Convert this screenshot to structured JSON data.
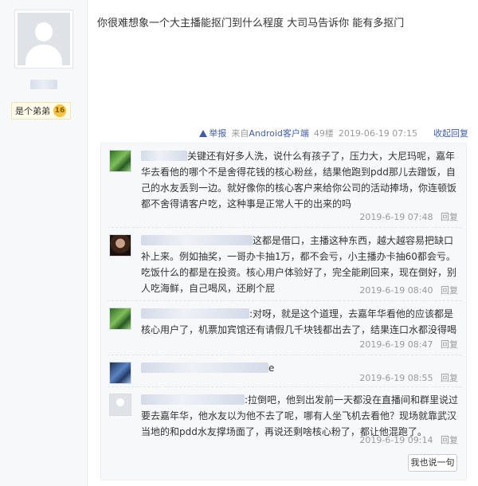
{
  "post": {
    "text": "你很难想象一个大主播能抠门到什么程度 大司马告诉你 能有多抠门",
    "rank_title": "是个弟弟",
    "rank_level": "16"
  },
  "meta": {
    "report": "举报",
    "client_prefix": "来自",
    "client_name": "Android客户端",
    "floor": "49楼",
    "time": "2019-06-19 07:15",
    "collapse": "收起回复"
  },
  "replies": [
    {
      "text": "关键还有好多人洗，说什么有孩子了，压力大，大尼玛呢，嘉年华去看他的哪个不是舍得花钱的核心粉丝，结果他跑到pdd那儿去蹭饭，自己的水友丢到一边。就好像你的核心客户来给你公司的活动捧场，你连顿饭都不舍得请客户吃，这种事是正常人干的出来的吗",
      "time": "2019-6-19 07:48",
      "reply_label": "回复"
    },
    {
      "text": "这都是借口，主播这种东西，越大越容易把缺口补上来。例如抽奖，一哥办卡抽1万，都不会亏，小主播办卡抽60都会亏。吃饭什么的都是在投资。核心用户体验好了，完全能刷回来，现在倒好，别人吃海鲜，自己喝风，还刷个屁",
      "time": "2019-6-19 08:40",
      "reply_label": "回复"
    },
    {
      "text": ":对呀，就是这个道理，去嘉年华看他的应该都是核心用户了，机票加宾馆还有请假几千块钱都出去了，结果连口水都没得喝",
      "time": "2019-6-19 08:47",
      "reply_label": "回复"
    },
    {
      "text": "e",
      "time": "2019-6-19 08:55",
      "reply_label": "回复"
    },
    {
      "text": ":拉倒吧，他到出发前一天都没在直播间和群里说过要去嘉年华，他水友以为他不去了呢，哪有人坐飞机去看他？现场就靠武汉当地的和pdd水友撑场面了，再说还剩啥核心粉了，都让他混跑了。",
      "time": "2019-6-19 09:14",
      "reply_label": "回复"
    }
  ],
  "say_button": "我也说一句"
}
